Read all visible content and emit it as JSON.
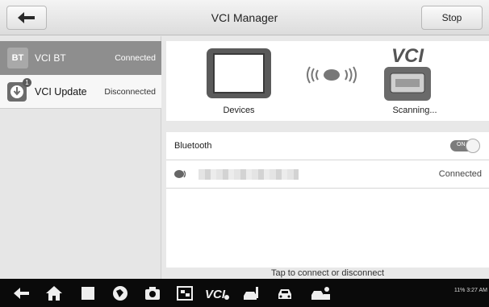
{
  "header": {
    "title": "VCI Manager",
    "back_icon": "back-arrow-icon",
    "stop_label": "Stop"
  },
  "sidebar": {
    "items": [
      {
        "badge": "BT",
        "name": "VCI BT",
        "status": "Connected",
        "active": true
      },
      {
        "badge_icon": "download-icon",
        "notification_count": "1",
        "name": "VCI Update",
        "status": "Disconnected",
        "active": false
      }
    ]
  },
  "connection": {
    "devices_label": "Devices",
    "vci_text": "VCI",
    "scanning_label": "Scanning..."
  },
  "bluetooth": {
    "label": "Bluetooth",
    "toggle_text": "ON",
    "device_status": "Connected"
  },
  "hint": "Tap to connect or disconnect",
  "navbar": {
    "icons": [
      "back-icon",
      "home-icon",
      "recent-apps-icon",
      "browser-icon",
      "camera-icon",
      "screenshot-icon",
      "vci-icon",
      "diagnostics-icon",
      "car-icon",
      "service-car-icon"
    ],
    "status_text": "11% 3:27 AM"
  },
  "colors": {
    "active_item_bg": "#8e8e8e",
    "navbar_bg": "#0a0a0a",
    "panel_bg": "#ffffff",
    "toggle_bg": "#7c7c7c"
  }
}
